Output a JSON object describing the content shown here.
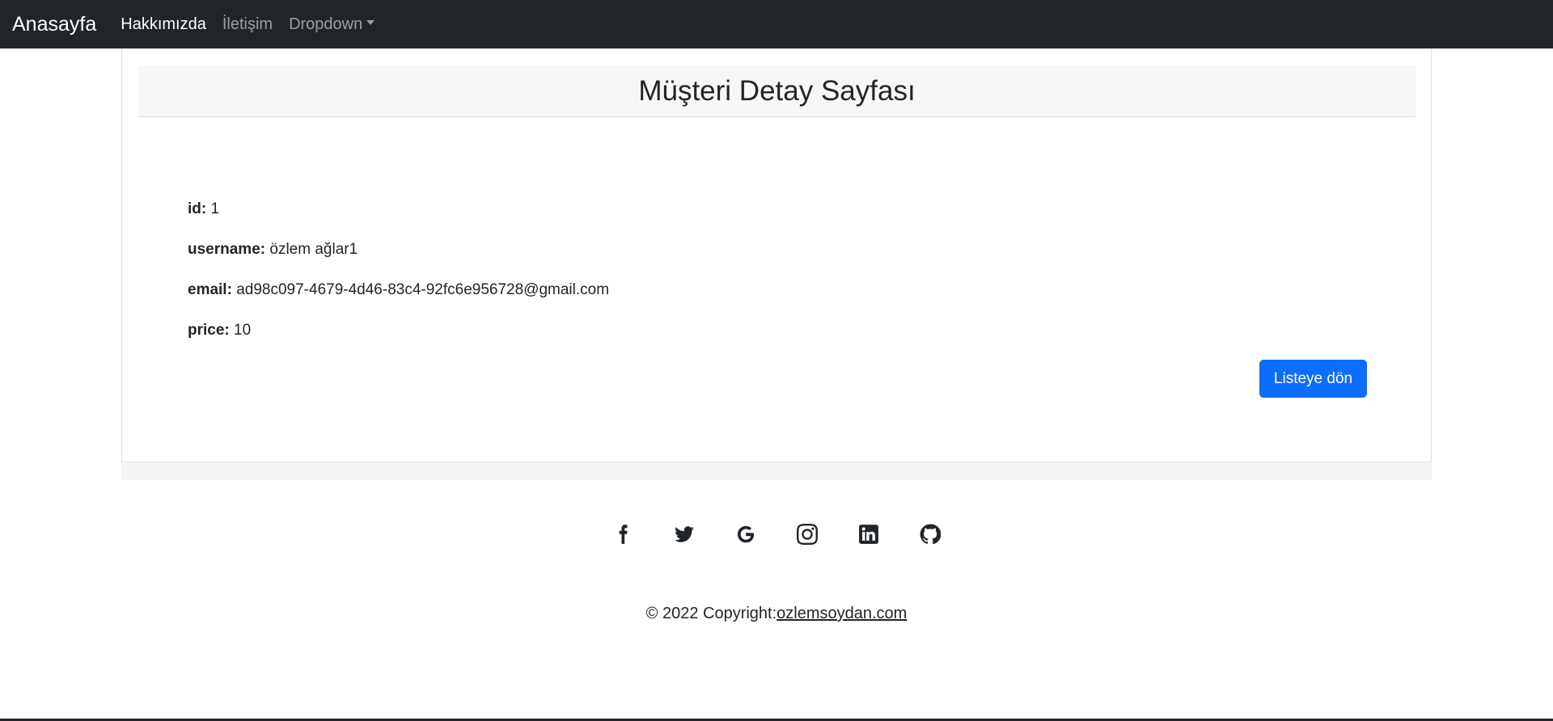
{
  "navbar": {
    "brand": "Anasayfa",
    "links": [
      {
        "label": "Hakkımızda"
      },
      {
        "label": "İletişim"
      },
      {
        "label": "Dropdown"
      }
    ]
  },
  "card": {
    "title": "Müşteri Detay Sayfası",
    "fields": [
      {
        "label": "id:",
        "value": "1"
      },
      {
        "label": "username:",
        "value": "özlem ağlar1"
      },
      {
        "label": "email:",
        "value": "ad98c097-4679-4d46-83c4-92fc6e956728@gmail.com"
      },
      {
        "label": "price:",
        "value": "10"
      }
    ],
    "back_button": "Listeye dön"
  },
  "footer": {
    "social_icons": [
      "facebook-icon",
      "twitter-icon",
      "google-icon",
      "instagram-icon",
      "linkedin-icon",
      "github-icon"
    ],
    "copyright_prefix": "© 2022 Copyright:",
    "copyright_link": "ozlemsoydan.com"
  },
  "colors": {
    "navbar_bg": "#212529",
    "primary": "#0d6efd",
    "header_bg": "#f7f7f7"
  }
}
